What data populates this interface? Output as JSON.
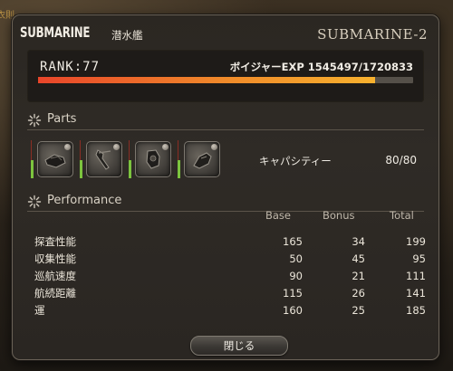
{
  "background_hint": "衣則",
  "window": {
    "title": "SUBMARINE",
    "title_sub": "潜水艦",
    "name": "SUBMARINE-2"
  },
  "rank": {
    "label": "RANK:77",
    "exp_label": "ボイジャーEXP 1545497/1720833",
    "exp_current": 1545497,
    "exp_max": 1720833,
    "fill_fraction": 0.898
  },
  "parts": {
    "header": "Parts",
    "items": [
      {
        "icon": "submarine-hull-part-icon"
      },
      {
        "icon": "submarine-stern-part-icon"
      },
      {
        "icon": "submarine-bow-part-icon"
      },
      {
        "icon": "submarine-bridge-part-icon"
      }
    ],
    "capacity_label": "キャパシティー",
    "capacity_value": "80/80"
  },
  "performance": {
    "header": "Performance",
    "columns": [
      "Base",
      "Bonus",
      "Total"
    ],
    "rows": [
      {
        "name": "探査性能",
        "base": "165",
        "bonus": "34",
        "total": "199"
      },
      {
        "name": "収集性能",
        "base": "50",
        "bonus": "45",
        "total": "95"
      },
      {
        "name": "巡航速度",
        "base": "90",
        "bonus": "21",
        "total": "111"
      },
      {
        "name": "航続距離",
        "base": "115",
        "bonus": "26",
        "total": "141"
      },
      {
        "name": "運",
        "base": "160",
        "bonus": "25",
        "total": "185"
      }
    ]
  },
  "buttons": {
    "close_label": "閉じる"
  },
  "colors": {
    "exp_bar_start": "#e8452a",
    "exp_bar_end": "#f7b12e",
    "part_indicator": "#7cc43e"
  }
}
